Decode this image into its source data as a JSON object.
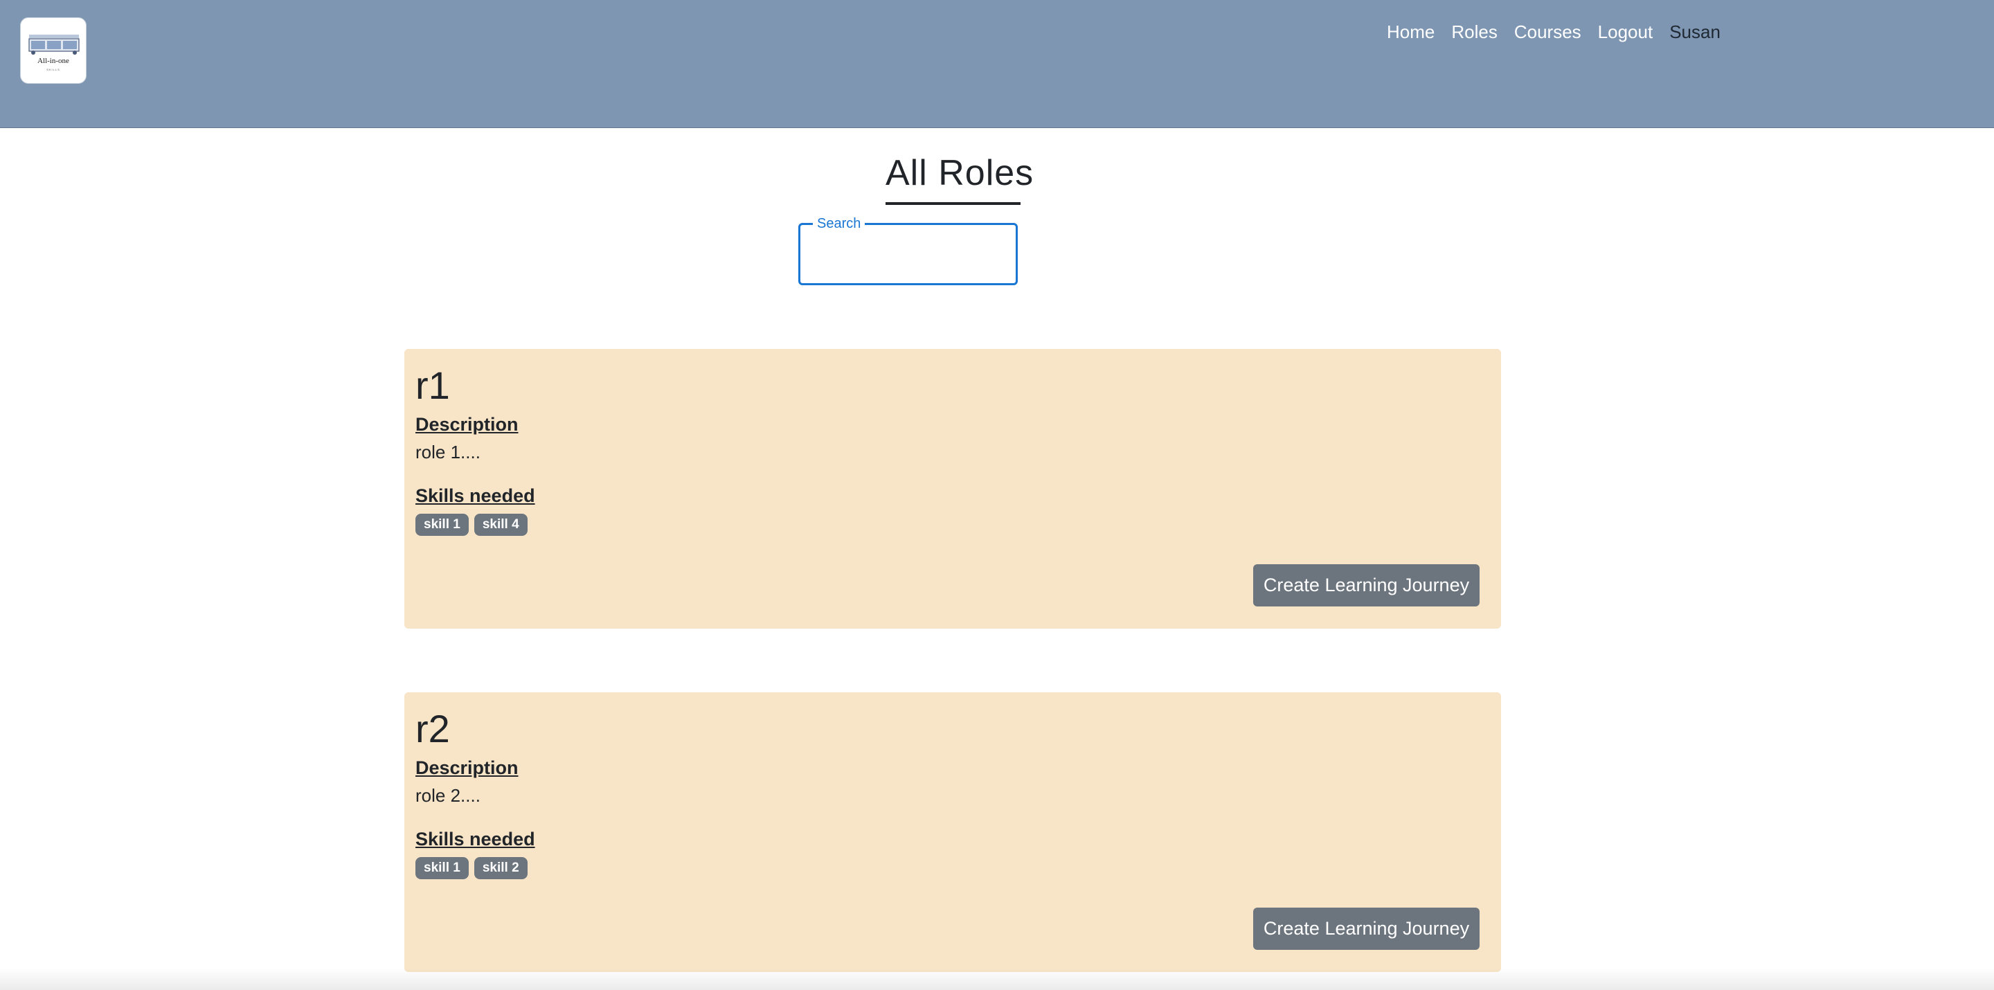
{
  "nav": {
    "logo": {
      "text": "All-in-one",
      "subtext": "SKILLS"
    },
    "links": [
      {
        "label": "Home"
      },
      {
        "label": "Roles"
      },
      {
        "label": "Courses"
      },
      {
        "label": "Logout"
      }
    ],
    "user": "Susan"
  },
  "page": {
    "title": "All Roles"
  },
  "search": {
    "label": "Search",
    "value": ""
  },
  "labels": {
    "description": "Description",
    "skills_needed": "Skills needed",
    "create_button": "Create Learning Journey"
  },
  "roles": [
    {
      "name": "r1",
      "description": "role 1....",
      "skills": [
        "skill 1",
        "skill 4"
      ]
    },
    {
      "name": "r2",
      "description": "role 2....",
      "skills": [
        "skill 1",
        "skill 2"
      ]
    }
  ],
  "colors": {
    "navbar": "#7e96b2",
    "card": "#f8e4c6",
    "badge": "#6c757d",
    "button": "#6c757d",
    "search_accent": "#1976d2"
  }
}
